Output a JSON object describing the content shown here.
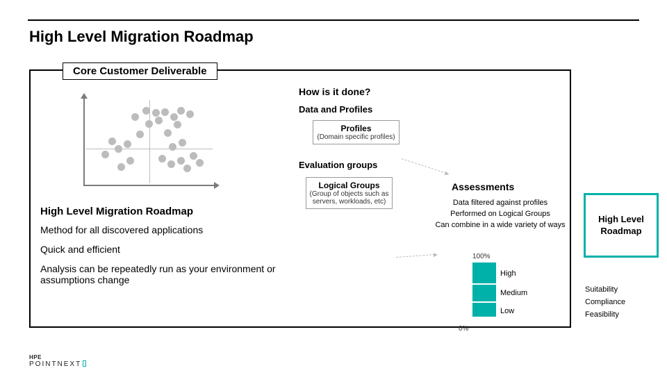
{
  "title": "High Level Migration Roadmap",
  "badge": "Core Customer Deliverable",
  "left": {
    "heading": "High Level Migration Roadmap",
    "l1": "Method for all discovered applications",
    "l2": "Quick and efficient",
    "l3": "Analysis can be repeatedly run as your environment or assumptions change"
  },
  "mid": {
    "heading": "How is it done?",
    "sub1": "Data and Profiles",
    "profiles_title": "Profiles",
    "profiles_sub": "(Domain specific profiles)",
    "eval_title": "Evaluation groups",
    "lg_title": "Logical Groups",
    "lg_sub": "(Group of objects such as servers, workloads, etc)"
  },
  "assess": {
    "heading": "Assessments",
    "l1": "Data filtered against profiles",
    "l2": "Performed on Logical Groups",
    "l3": "Can combine in a wide variety of ways"
  },
  "waterfall": {
    "tick_top": "100%",
    "tick_bot": "0%",
    "b1": "High",
    "b2": "Medium",
    "b3": "Low"
  },
  "wf_right": {
    "r1": "Suitability",
    "r2": "Compliance",
    "r3": "Feasibility"
  },
  "teal": "High Level Roadmap",
  "logo": {
    "top": "HPE",
    "bottom": "POINTNEXT"
  },
  "chart_data": {
    "type": "scatter",
    "title": "",
    "xlabel": "",
    "ylabel": "",
    "xlim": [
      0,
      100
    ],
    "ylim": [
      0,
      100
    ],
    "points": [
      [
        12,
        35
      ],
      [
        18,
        52
      ],
      [
        25,
        20
      ],
      [
        23,
        42
      ],
      [
        32,
        28
      ],
      [
        30,
        48
      ],
      [
        36,
        82
      ],
      [
        45,
        90
      ],
      [
        47,
        73
      ],
      [
        53,
        87
      ],
      [
        40,
        60
      ],
      [
        55,
        78
      ],
      [
        60,
        88
      ],
      [
        67,
        82
      ],
      [
        73,
        90
      ],
      [
        62,
        62
      ],
      [
        70,
        72
      ],
      [
        80,
        85
      ],
      [
        58,
        30
      ],
      [
        65,
        23
      ],
      [
        73,
        28
      ],
      [
        78,
        18
      ],
      [
        83,
        34
      ],
      [
        88,
        25
      ],
      [
        66,
        45
      ],
      [
        74,
        50
      ]
    ]
  }
}
